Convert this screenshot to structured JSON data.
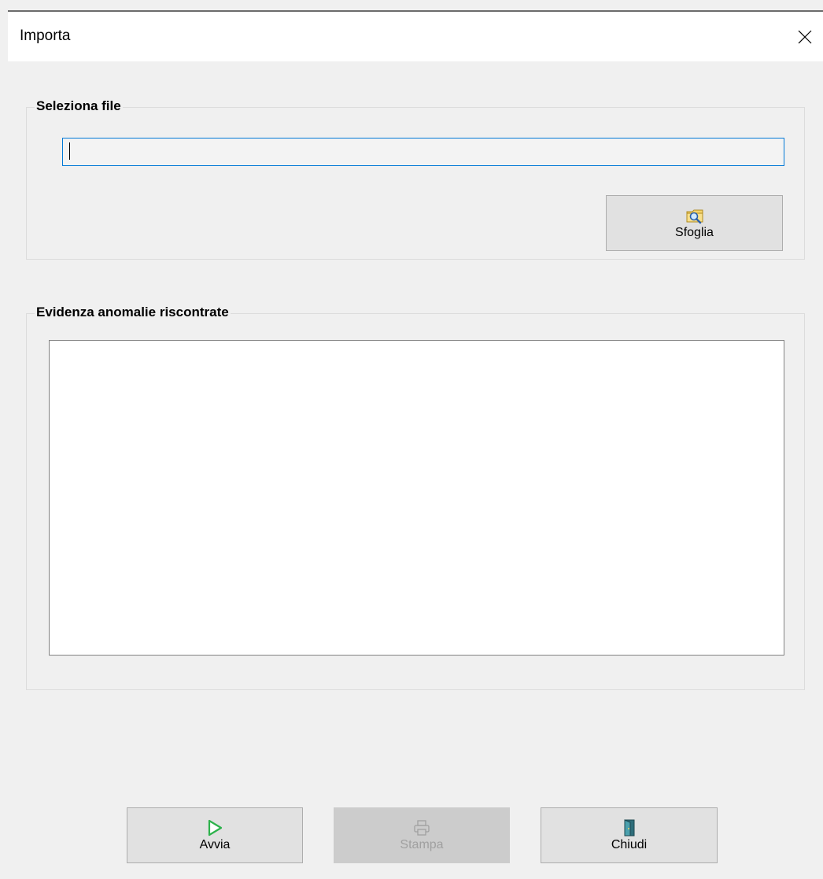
{
  "window": {
    "title": "Importa"
  },
  "file_group": {
    "legend": "Seleziona file",
    "path_value": "",
    "browse_label": "Sfoglia"
  },
  "anomalies_group": {
    "legend": "Evidenza anomalie riscontrate",
    "content": ""
  },
  "footer": {
    "start_label": "Avvia",
    "print_label": "Stampa",
    "close_label": "Chiudi"
  },
  "icons": {
    "close": "close-icon",
    "browse": "folder-search-icon",
    "start": "play-icon",
    "print": "printer-icon",
    "exit": "door-exit-icon"
  }
}
